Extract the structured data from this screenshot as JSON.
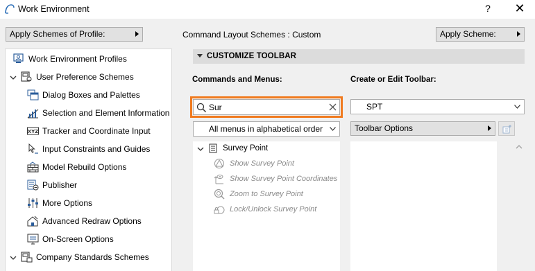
{
  "window": {
    "title": "Work Environment",
    "help": "?",
    "close": "✕"
  },
  "profile_button": {
    "label": "Apply Schemes of Profile:"
  },
  "layout_label": "Command Layout Schemes : Custom",
  "apply_scheme_button": {
    "label": "Apply Scheme:"
  },
  "tree": {
    "items": [
      {
        "label": "Work Environment Profiles",
        "icon": "profiles-icon"
      },
      {
        "label": "User Preference Schemes",
        "icon": "user-preferences-icon",
        "expanded": true
      },
      {
        "label": "Dialog Boxes and Palettes",
        "icon": "dialog-boxes-icon"
      },
      {
        "label": "Selection and Element Information",
        "icon": "selection-info-icon"
      },
      {
        "label": "Tracker and Coordinate Input",
        "icon": "xyz-tracker-icon",
        "icon_text": "XYZ"
      },
      {
        "label": "Input Constraints and Guides",
        "icon": "input-constraints-icon"
      },
      {
        "label": "Model Rebuild Options",
        "icon": "model-rebuild-icon"
      },
      {
        "label": "Publisher",
        "icon": "publisher-icon"
      },
      {
        "label": "More Options",
        "icon": "more-options-icon"
      },
      {
        "label": "Advanced Redraw Options",
        "icon": "advanced-redraw-icon"
      },
      {
        "label": "On-Screen Options",
        "icon": "on-screen-options-icon"
      },
      {
        "label": "Company Standards Schemes",
        "icon": "company-standards-icon",
        "expanded": true
      }
    ]
  },
  "section": {
    "title": "CUSTOMIZE TOOLBAR"
  },
  "commands": {
    "label": "Commands and Menus:",
    "search_value": "Sur",
    "menu_filter": "All menus in alphabetical order",
    "results": {
      "group": "Survey Point",
      "items": [
        {
          "label": "Show Survey Point",
          "icon": "show-survey-point-icon"
        },
        {
          "label": "Show Survey Point Coordinates",
          "icon": "survey-coordinates-icon"
        },
        {
          "label": "Zoom to Survey Point",
          "icon": "zoom-survey-point-icon"
        },
        {
          "label": "Lock/Unlock Survey Point",
          "icon": "lock-survey-point-icon"
        }
      ]
    }
  },
  "toolbar": {
    "label": "Create or Edit Toolbar:",
    "selected": "SPT",
    "options_label": "Toolbar Options"
  },
  "colors": {
    "search_highlight": "#f07a1e",
    "section_header": "#dcdcdc"
  }
}
